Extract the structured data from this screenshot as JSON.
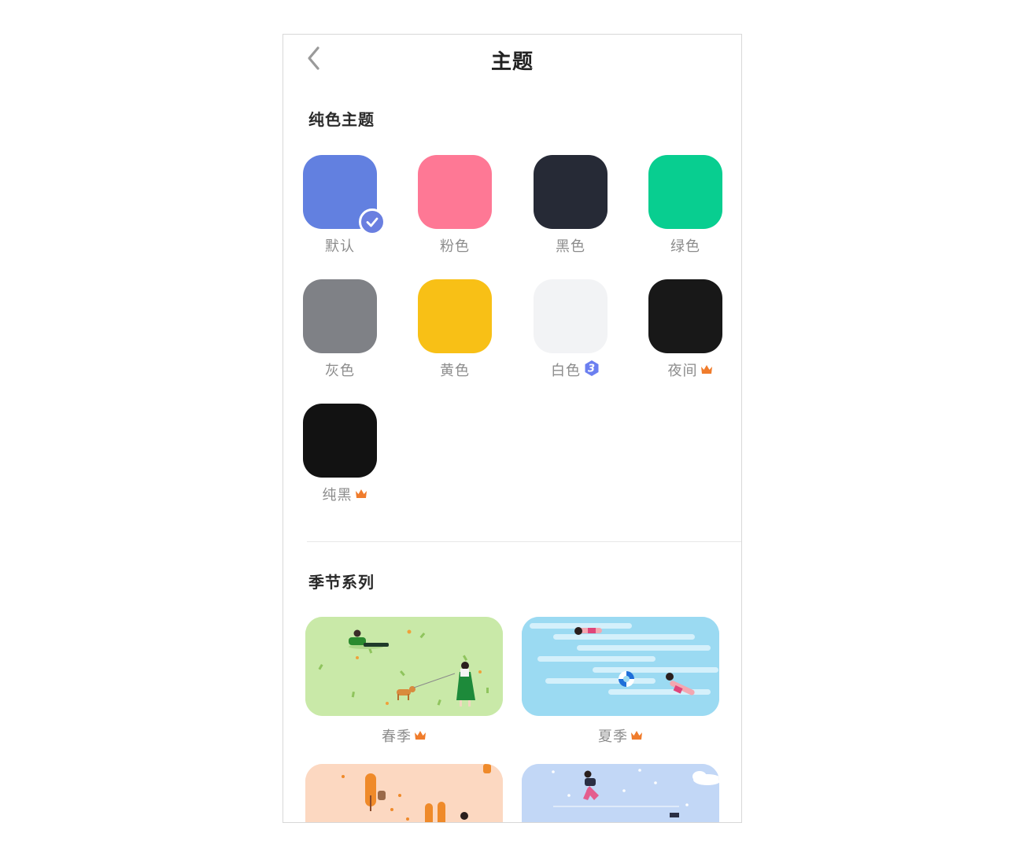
{
  "header": {
    "title": "主题",
    "back_icon": "chevron-left-icon"
  },
  "solid_section": {
    "title": "纯色主题",
    "items": [
      {
        "label": "默认",
        "color": "#6280e0",
        "selected": true
      },
      {
        "label": "粉色",
        "color": "#fe7895"
      },
      {
        "label": "黑色",
        "color": "#262a36"
      },
      {
        "label": "绿色",
        "color": "#08ce90"
      },
      {
        "label": "灰色",
        "color": "#7f8186"
      },
      {
        "label": "黄色",
        "color": "#f8c016"
      },
      {
        "label": "白色",
        "color": "#f2f3f5",
        "badge": "3",
        "badge_icon": "level-hexagon-icon"
      },
      {
        "label": "夜间",
        "color": "#181818",
        "badge_icon": "crown-icon"
      },
      {
        "label": "纯黑",
        "color": "#121212",
        "badge_icon": "crown-icon"
      }
    ]
  },
  "season_section": {
    "title": "季节系列",
    "items": [
      {
        "label": "春季",
        "badge_icon": "crown-icon",
        "bg": "#c7e8a6"
      },
      {
        "label": "夏季",
        "badge_icon": "crown-icon",
        "bg": "#9ad9f2"
      },
      {
        "label": "",
        "bg": "#fcd7c0"
      },
      {
        "label": "",
        "bg": "#c1d6f5"
      }
    ]
  },
  "colors": {
    "crown": "#f07c2c",
    "badge_hex": "#6b7ff0",
    "label": "#8c8c8c"
  }
}
